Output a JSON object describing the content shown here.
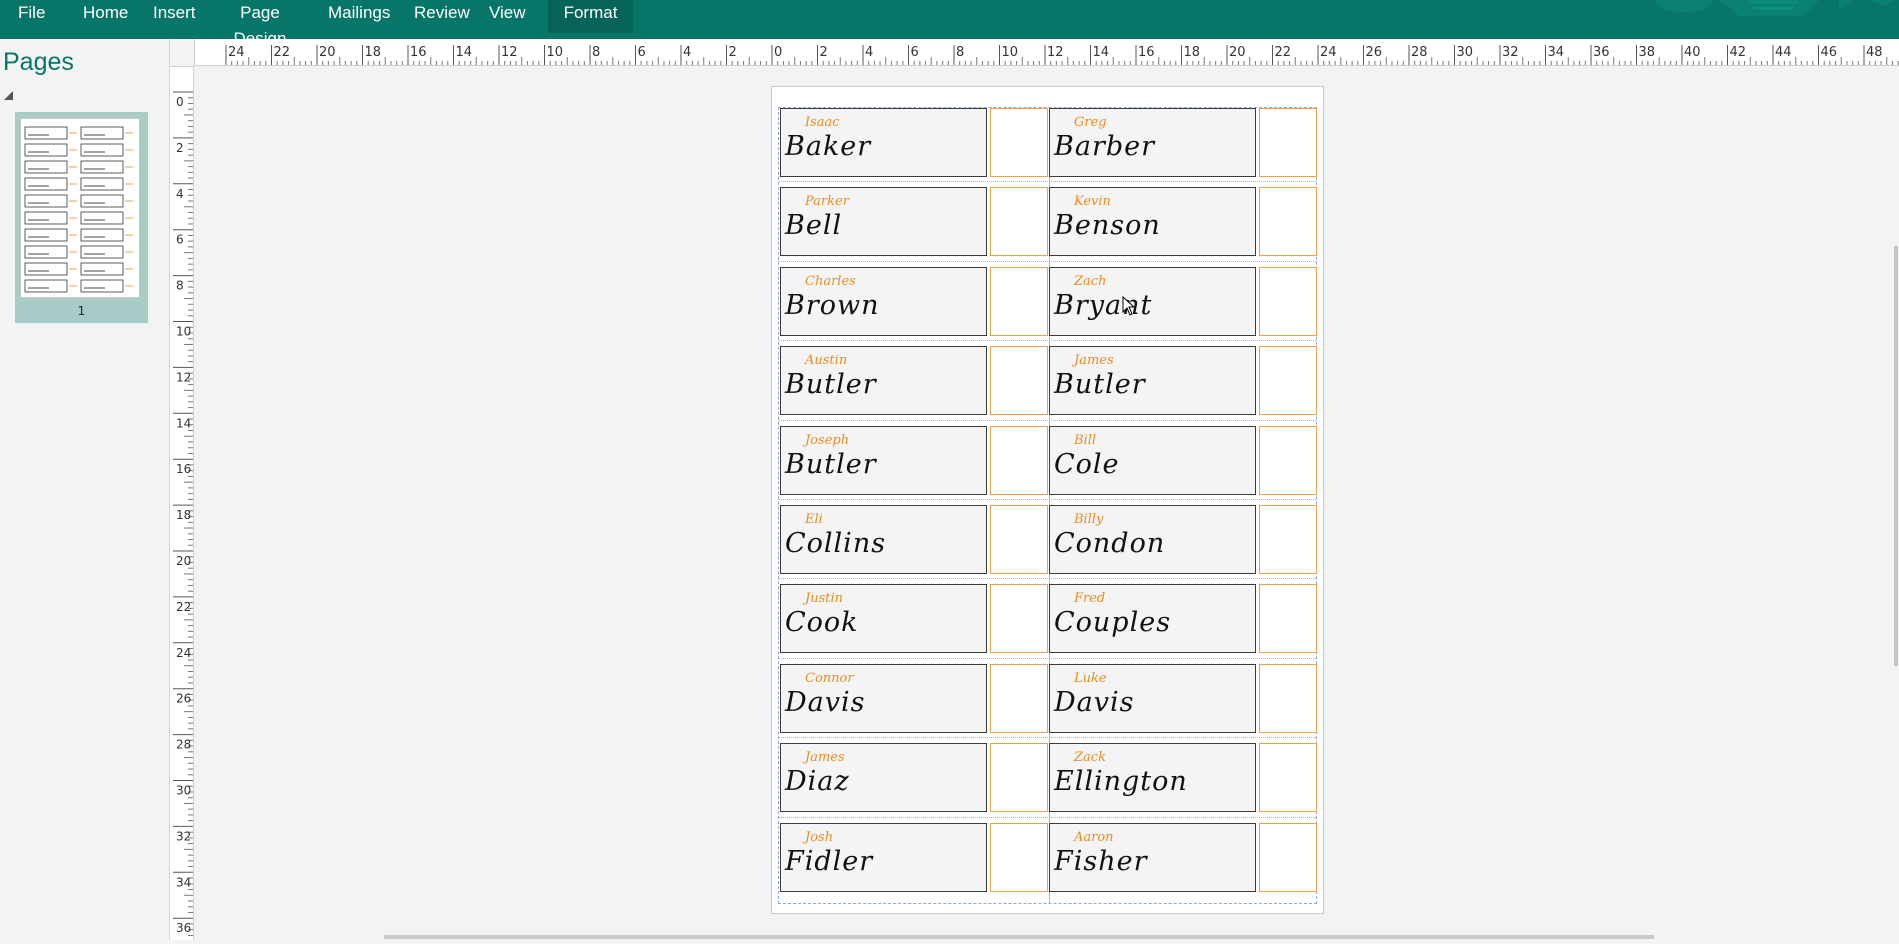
{
  "ribbon": {
    "tabs": [
      {
        "label": "File",
        "active": false
      },
      {
        "label": "Home",
        "active": false
      },
      {
        "label": "Insert",
        "active": false
      },
      {
        "label": "Page Design",
        "active": false
      },
      {
        "label": "Mailings",
        "active": false
      },
      {
        "label": "Review",
        "active": false
      },
      {
        "label": "View",
        "active": false
      },
      {
        "label": "Format",
        "active": true
      }
    ]
  },
  "pages_pane": {
    "title": "Pages",
    "thumbnail_number": "1"
  },
  "ruler": {
    "horizontal_ticks": [
      "24",
      "22",
      "20",
      "18",
      "16",
      "14",
      "12",
      "10",
      "8",
      "6",
      "4",
      "2",
      "0",
      "2",
      "4",
      "6",
      "8",
      "10",
      "12",
      "14",
      "16",
      "18",
      "20",
      "22",
      "24",
      "26",
      "28",
      "30",
      "32",
      "34",
      "36",
      "38",
      "40",
      "42",
      "44",
      "46",
      "48"
    ],
    "vertical_ticks": [
      "0",
      "2",
      "4",
      "6",
      "8",
      "10",
      "12",
      "14",
      "16",
      "18",
      "20",
      "22",
      "24",
      "26",
      "28",
      "30",
      "32",
      "34",
      "36"
    ]
  },
  "labels": [
    {
      "first": "Isaac",
      "last": "Baker"
    },
    {
      "first": "Greg",
      "last": "Barber"
    },
    {
      "first": "Parker",
      "last": "Bell"
    },
    {
      "first": "Kevin",
      "last": "Benson"
    },
    {
      "first": "Charles",
      "last": "Brown"
    },
    {
      "first": "Zach",
      "last": "Bryant"
    },
    {
      "first": "Austin",
      "last": "Butler"
    },
    {
      "first": "James",
      "last": "Butler"
    },
    {
      "first": "Joseph",
      "last": "Butler"
    },
    {
      "first": "Bill",
      "last": "Cole"
    },
    {
      "first": "Eli",
      "last": "Collins"
    },
    {
      "first": "Billy",
      "last": "Condon"
    },
    {
      "first": "Justin",
      "last": "Cook"
    },
    {
      "first": "Fred",
      "last": "Couples"
    },
    {
      "first": "Connor",
      "last": "Davis"
    },
    {
      "first": "Luke",
      "last": "Davis"
    },
    {
      "first": "James",
      "last": "Diaz"
    },
    {
      "first": "Zack",
      "last": "Ellington"
    },
    {
      "first": "Josh",
      "last": "Fidler"
    },
    {
      "first": "Aaron",
      "last": "Fisher"
    }
  ],
  "colors": {
    "ribbon": "#077568",
    "accent_orange": "#e98c1f",
    "pages_title": "#077568"
  }
}
